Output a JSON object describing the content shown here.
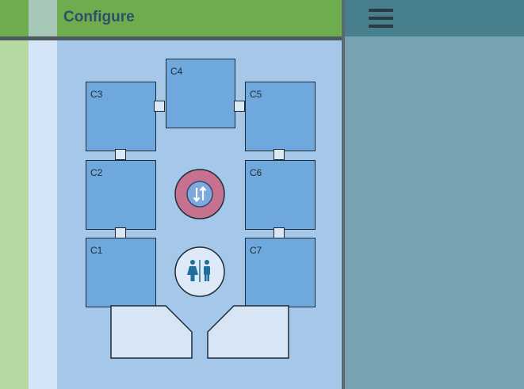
{
  "header": {
    "title": "Configure"
  },
  "menu": {
    "icon": "hamburger-menu-icon"
  },
  "cabins": [
    {
      "id": "c1",
      "label": "C1"
    },
    {
      "id": "c2",
      "label": "C2"
    },
    {
      "id": "c3",
      "label": "C3"
    },
    {
      "id": "c4",
      "label": "C4"
    },
    {
      "id": "c5",
      "label": "C5"
    },
    {
      "id": "c6",
      "label": "C6"
    },
    {
      "id": "c7",
      "label": "C7"
    }
  ],
  "features": {
    "elevator": {
      "icon": "elevator-up-down-icon"
    },
    "restroom": {
      "icon": "restroom-icon"
    }
  },
  "colors": {
    "header_green": "#6ead4d",
    "cabin_fill": "#6fa8dc",
    "plan_background": "#a5c8ea",
    "right_panel": "#77a3b1",
    "elevator_ring": "#c6728f",
    "restroom_icon": "#1f6f9a"
  }
}
